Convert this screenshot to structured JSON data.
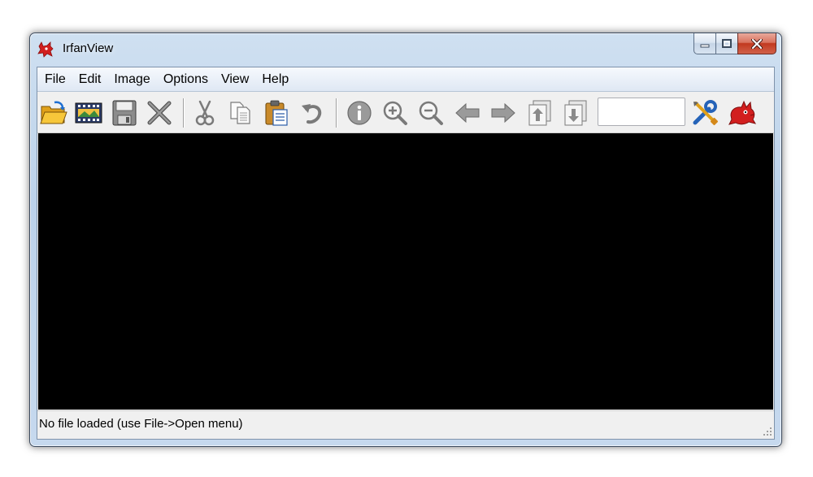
{
  "window": {
    "title": "IrfanView",
    "icon": "irfanview-red-cat-icon"
  },
  "caption_buttons": [
    "minimize-icon",
    "maximize-icon",
    "close-icon"
  ],
  "menu": {
    "items": [
      "File",
      "Edit",
      "Image",
      "Options",
      "View",
      "Help"
    ]
  },
  "toolbar": {
    "buttons": [
      {
        "icon": "open-folder-icon"
      },
      {
        "icon": "thumbnails-icon"
      },
      {
        "icon": "save-icon"
      },
      {
        "icon": "delete-icon"
      },
      {
        "icon": "cut-icon"
      },
      {
        "icon": "copy-icon"
      },
      {
        "icon": "paste-icon"
      },
      {
        "icon": "undo-icon"
      },
      {
        "icon": "info-icon"
      },
      {
        "icon": "zoom-in-icon"
      },
      {
        "icon": "zoom-out-icon"
      },
      {
        "icon": "previous-icon"
      },
      {
        "icon": "next-icon"
      },
      {
        "icon": "first-page-icon"
      },
      {
        "icon": "last-page-icon"
      },
      {
        "icon": "settings-icon"
      },
      {
        "icon": "about-icon"
      }
    ],
    "page_input_value": ""
  },
  "status": {
    "text": "No file loaded (use File->Open menu)"
  },
  "colors": {
    "viewport": "#000000",
    "accent_red": "#d21f1f",
    "folder_yellow": "#f2b520"
  }
}
